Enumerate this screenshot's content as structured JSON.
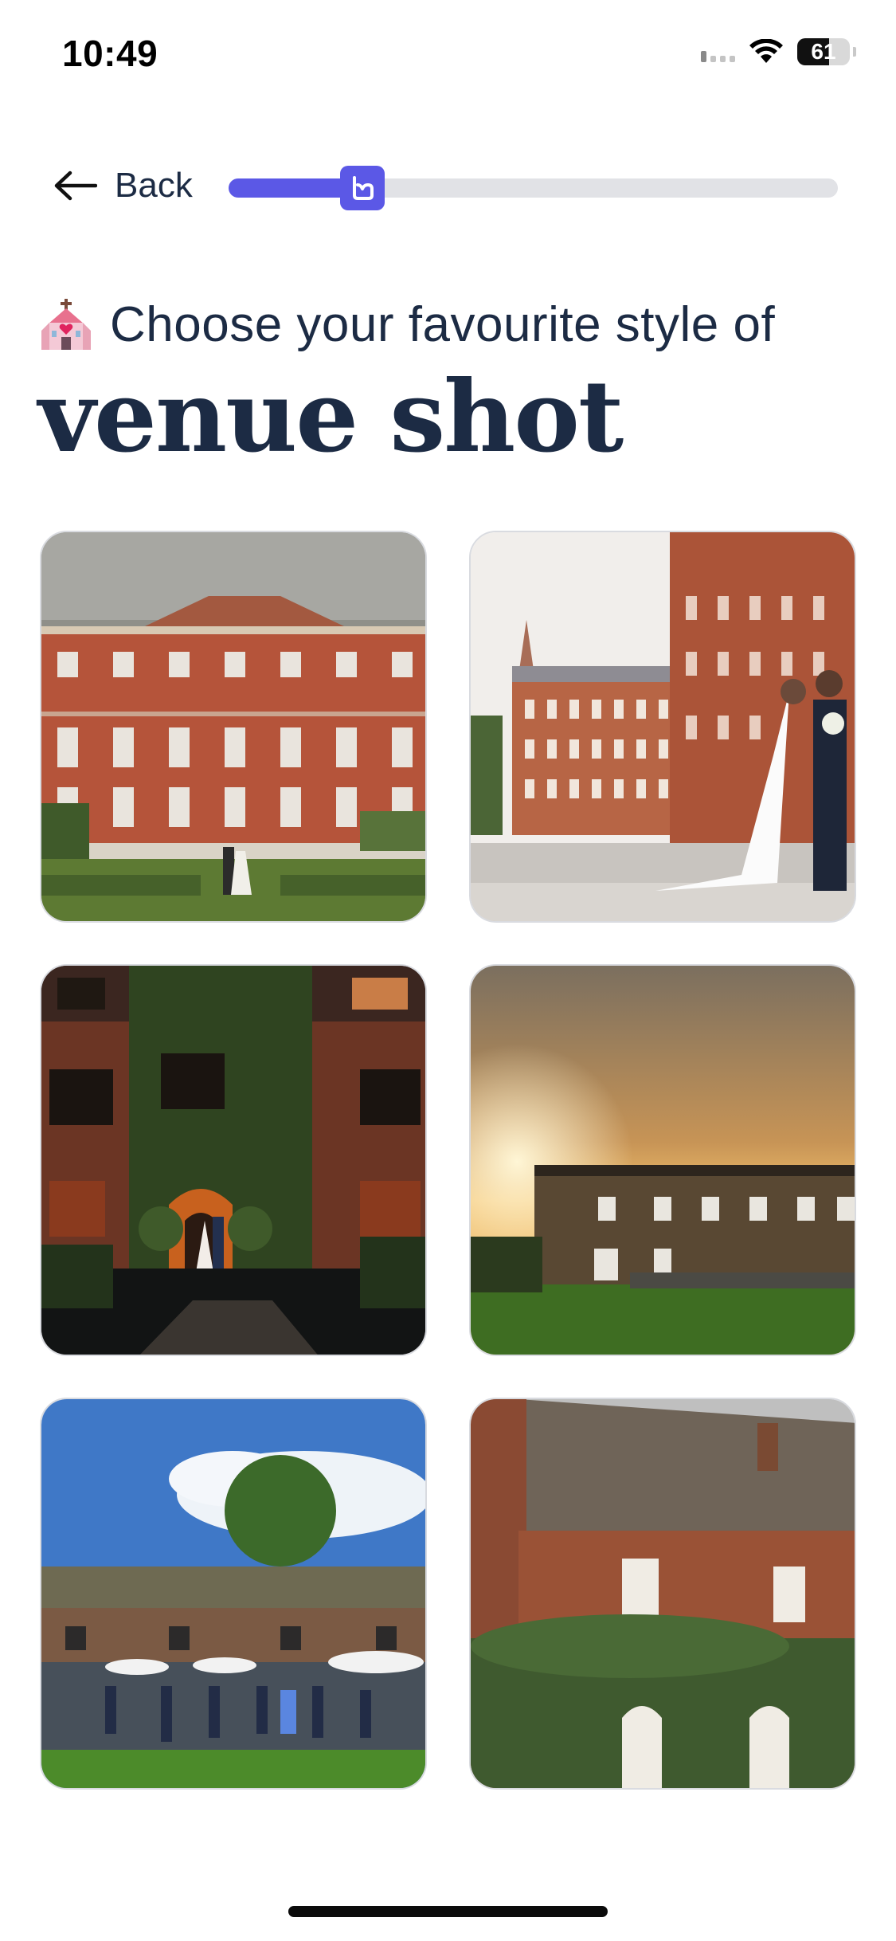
{
  "status_bar": {
    "time": "10:49",
    "battery": "61",
    "icons": [
      "signal-icon",
      "wifi-icon",
      "battery-icon"
    ]
  },
  "header": {
    "back_label": "Back",
    "progress_fraction": 0.22
  },
  "title": {
    "emoji": "wedding-chapel-icon",
    "prefix": "Choose your favourite style of",
    "main": "venue shot"
  },
  "options": [
    {
      "id": "venue-option-1",
      "description_icon": "photo-icon"
    },
    {
      "id": "venue-option-2",
      "description_icon": "photo-icon"
    },
    {
      "id": "venue-option-3",
      "description_icon": "photo-icon"
    },
    {
      "id": "venue-option-4",
      "description_icon": "photo-icon"
    },
    {
      "id": "venue-option-5",
      "description_icon": "photo-icon"
    },
    {
      "id": "venue-option-6",
      "description_icon": "photo-icon"
    }
  ],
  "colors": {
    "accent": "#5b58e6",
    "text": "#1c2b44",
    "track": "#e1e2e6"
  }
}
